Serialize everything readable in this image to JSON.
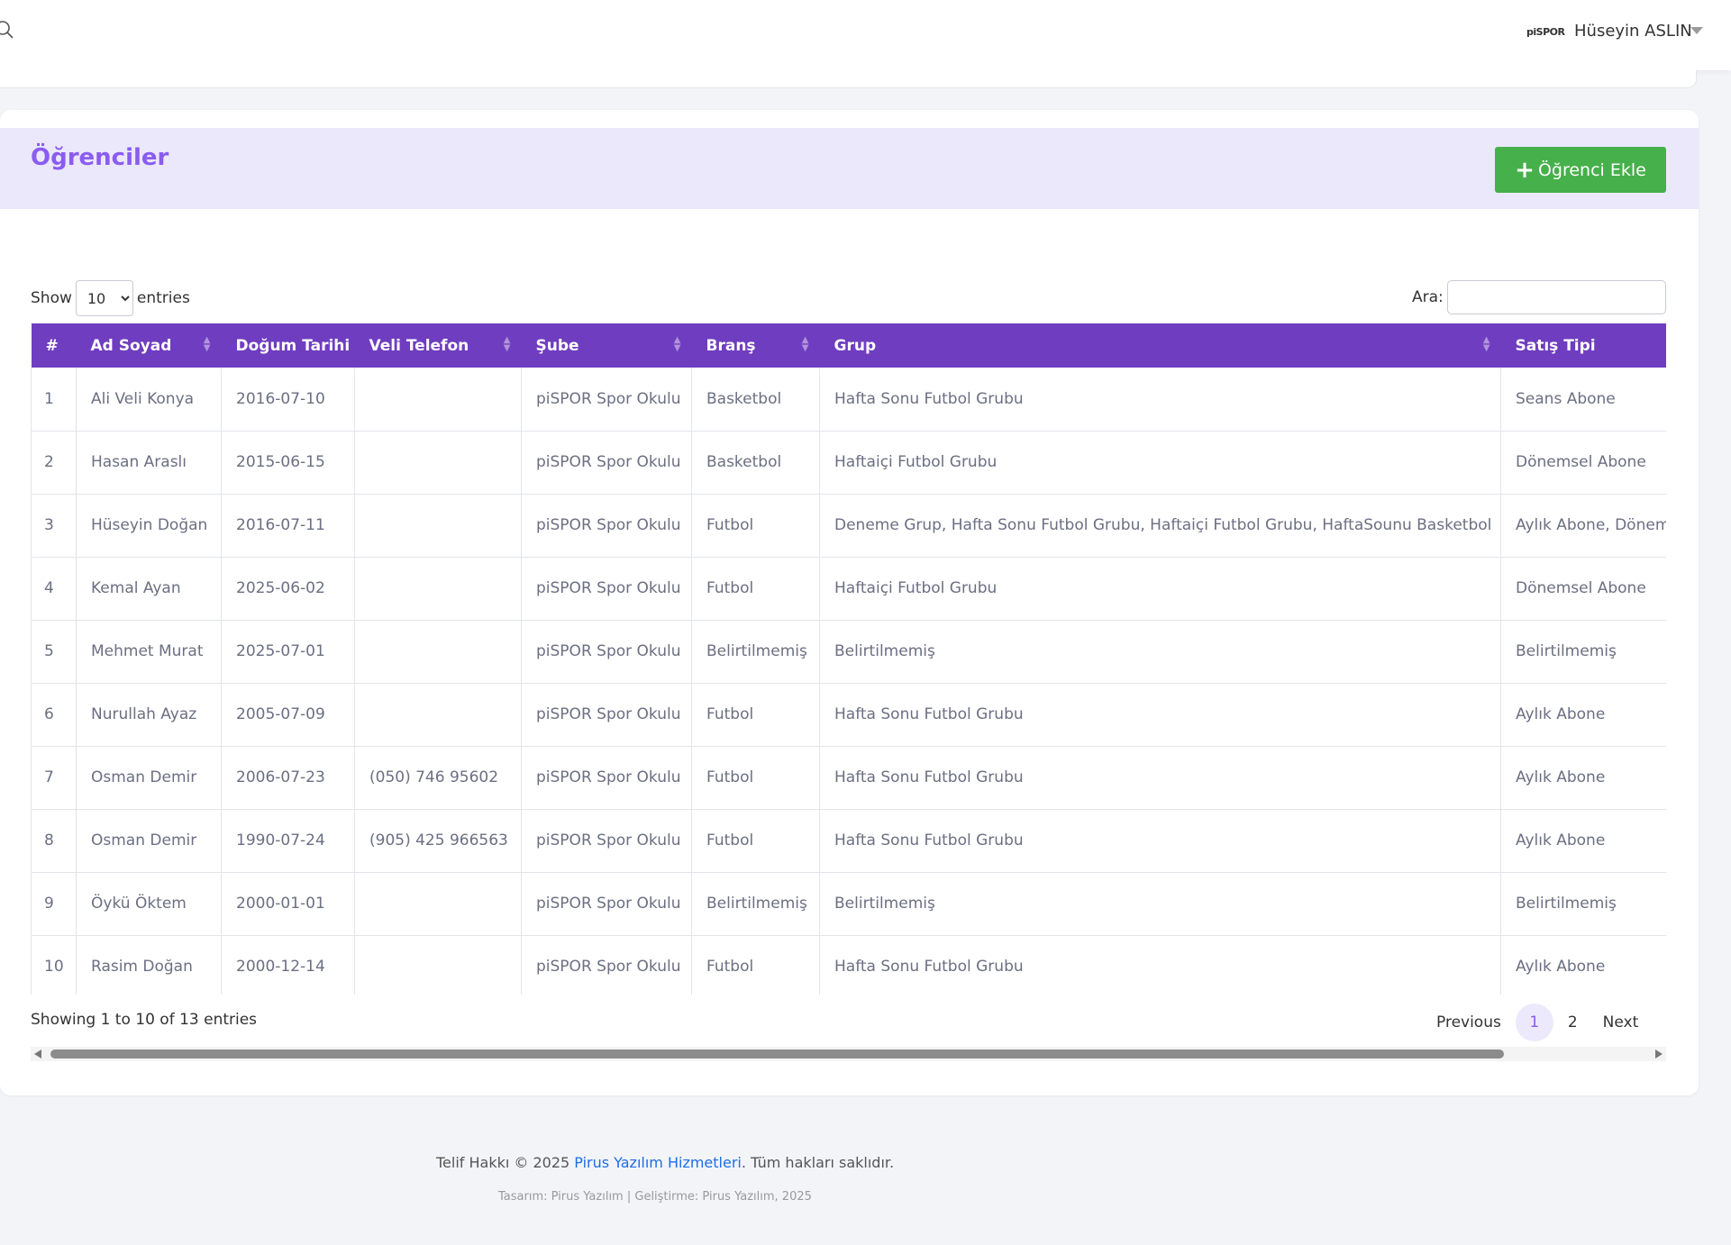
{
  "topbar": {
    "brand": "piSPOR",
    "user_name": "Hüseyin ASLIN"
  },
  "page": {
    "title": "Öğrenciler",
    "add_button": "Öğrenci Ekle"
  },
  "controls": {
    "show_label": "Show",
    "entries_label": "entries",
    "page_length": "10",
    "search_label": "Ara:"
  },
  "table": {
    "columns": [
      "#",
      "Ad Soyad",
      "Doğum Tarihi",
      "Veli Telefon",
      "Şube",
      "Branş",
      "Grup",
      "Satış Tipi"
    ],
    "rows": [
      [
        "1",
        "Ali Veli Konya",
        "2016-07-10",
        "",
        "piSPOR Spor Okulu",
        "Basketbol",
        "Hafta Sonu Futbol Grubu",
        "Seans Abone"
      ],
      [
        "2",
        "Hasan Araslı",
        "2015-06-15",
        "",
        "piSPOR Spor Okulu",
        "Basketbol",
        "Haftaiçi Futbol Grubu",
        "Dönemsel Abone"
      ],
      [
        "3",
        "Hüseyin Doğan",
        "2016-07-11",
        "",
        "piSPOR Spor Okulu",
        "Futbol",
        "Deneme Grup, Hafta Sonu Futbol Grubu, Haftaiçi Futbol Grubu, HaftaSounu Basketbol",
        "Aylık Abone, Dönem"
      ],
      [
        "4",
        "Kemal Ayan",
        "2025-06-02",
        "",
        "piSPOR Spor Okulu",
        "Futbol",
        "Haftaiçi Futbol Grubu",
        "Dönemsel Abone"
      ],
      [
        "5",
        "Mehmet Murat",
        "2025-07-01",
        "",
        "piSPOR Spor Okulu",
        "Belirtilmemiş",
        "Belirtilmemiş",
        "Belirtilmemiş"
      ],
      [
        "6",
        "Nurullah Ayaz",
        "2005-07-09",
        "",
        "piSPOR Spor Okulu",
        "Futbol",
        "Hafta Sonu Futbol Grubu",
        "Aylık Abone"
      ],
      [
        "7",
        "Osman Demir",
        "2006-07-23",
        "(050) 746 95602",
        "piSPOR Spor Okulu",
        "Futbol",
        "Hafta Sonu Futbol Grubu",
        "Aylık Abone"
      ],
      [
        "8",
        "Osman Demir",
        "1990-07-24",
        "(905) 425 966563",
        "piSPOR Spor Okulu",
        "Futbol",
        "Hafta Sonu Futbol Grubu",
        "Aylık Abone"
      ],
      [
        "9",
        "Öykü Öktem",
        "2000-01-01",
        "",
        "piSPOR Spor Okulu",
        "Belirtilmemiş",
        "Belirtilmemiş",
        "Belirtilmemiş"
      ],
      [
        "10",
        "Rasim Doğan",
        "2000-12-14",
        "",
        "piSPOR Spor Okulu",
        "Futbol",
        "Hafta Sonu Futbol Grubu",
        "Aylık Abone"
      ]
    ]
  },
  "table_footer": {
    "info": "Showing 1 to 10 of 13 entries",
    "previous": "Previous",
    "pages": [
      "1",
      "2"
    ],
    "next": "Next"
  },
  "footer": {
    "copyright_prefix": "Telif Hakkı © 2025 ",
    "company_link": "Pirus Yazılım Hizmetleri",
    "copyright_suffix": ". Tüm hakları saklıdır.",
    "credits": "Tasarım: Pirus Yazılım | Geliştirme: Pirus Yazılım, 2025"
  },
  "colors": {
    "accent": "#8a5cf0",
    "table_header": "#6f3dc0",
    "header_band": "#ebe8fb",
    "add_button": "#46b04a",
    "link": "#1e6ee8"
  },
  "icons": {
    "search": "search-icon",
    "user_menu": "caret-down-icon",
    "add": "plus-icon",
    "sort": "sort-icon"
  }
}
